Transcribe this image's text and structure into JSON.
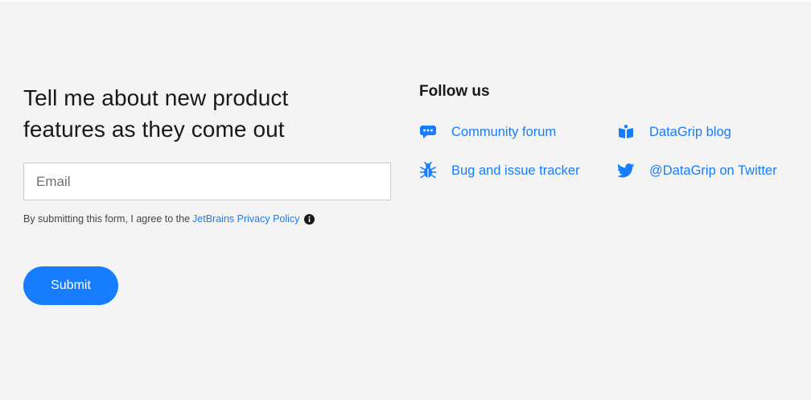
{
  "newsletter": {
    "headline": "Tell me about new product\nfeatures as they come out",
    "email_placeholder": "Email",
    "consent_text": "By submitting this form, I agree to the",
    "privacy_link": "JetBrains Privacy Policy",
    "submit_label": "Submit"
  },
  "follow": {
    "title": "Follow us",
    "links": [
      {
        "label": "Community forum",
        "icon": "chat-bubble-icon"
      },
      {
        "label": "DataGrip blog",
        "icon": "book-icon"
      },
      {
        "label": "Bug and issue tracker",
        "icon": "bug-icon"
      },
      {
        "label": "@DataGrip on Twitter",
        "icon": "twitter-icon"
      }
    ]
  },
  "colors": {
    "accent": "#167dff",
    "background": "#f4f4f4",
    "text": "#19191c"
  }
}
